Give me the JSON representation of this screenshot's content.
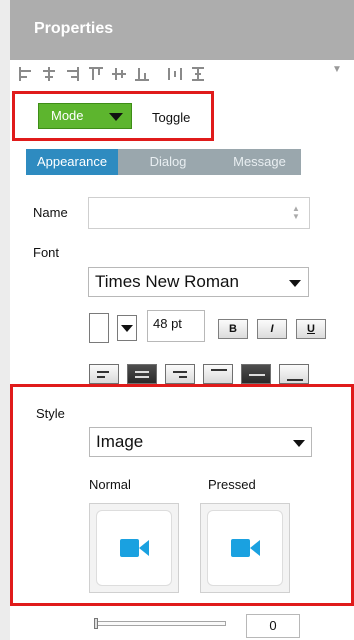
{
  "header": {
    "title": "Properties"
  },
  "toolbar": {
    "icons": [
      "align-left-icon",
      "align-center-icon",
      "align-right-icon",
      "align-top-icon",
      "align-middle-icon",
      "align-bottom-icon",
      "distribute-horizontal-icon",
      "distribute-vertical-icon"
    ],
    "more": "▼"
  },
  "mode": {
    "label": "Mode",
    "value": "Toggle"
  },
  "tabs": [
    {
      "label": "Appearance",
      "active": true
    },
    {
      "label": "Dialog",
      "active": false
    },
    {
      "label": "Message",
      "active": false
    }
  ],
  "fields": {
    "name_label": "Name",
    "name_value": "",
    "font_label": "Font",
    "font_family": "Times New Roman",
    "font_size": "48 pt",
    "bold": "B",
    "italic": "I",
    "underline": "U"
  },
  "paragraph": [
    "align-left-icon",
    "align-center-icon",
    "align-right-icon",
    "align-top-icon",
    "align-middle-icon",
    "align-bottom-icon"
  ],
  "style": {
    "label": "Style",
    "value": "Image",
    "normal_label": "Normal",
    "pressed_label": "Pressed",
    "icon_color": "#1aa1e0"
  },
  "slider": {
    "value": "0"
  }
}
